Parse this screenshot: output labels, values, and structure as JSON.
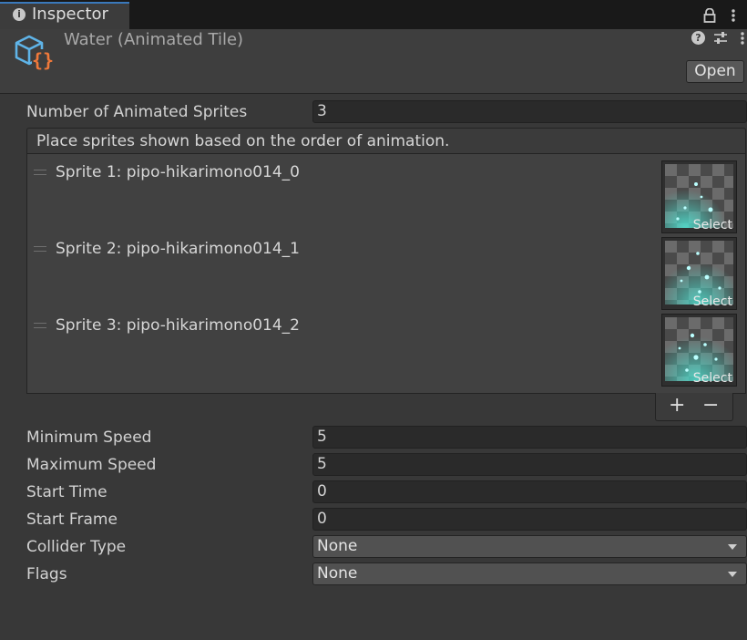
{
  "tab": {
    "label": "Inspector",
    "info_icon": "info-icon",
    "lock_icon": "lock-icon",
    "menu_icon": "kebab-menu-icon"
  },
  "header": {
    "title": "Water (Animated Tile)",
    "asset_icon": "scriptable-object-icon",
    "help_icon": "help-icon",
    "preset_icon": "presets-icon",
    "menu_icon": "kebab-menu-icon",
    "open_label": "Open"
  },
  "num_sprites": {
    "label": "Number of Animated Sprites",
    "value": "3"
  },
  "sprite_list": {
    "header": "Place sprites shown based on the order of animation.",
    "items": [
      {
        "label": "Sprite 1: pipo-hikarimono014_0",
        "select": "Select"
      },
      {
        "label": "Sprite 2: pipo-hikarimono014_1",
        "select": "Select"
      },
      {
        "label": "Sprite 3: pipo-hikarimono014_2",
        "select": "Select"
      }
    ],
    "add_label": "+",
    "remove_label": "−"
  },
  "fields": {
    "min_speed": {
      "label": "Minimum Speed",
      "value": "5"
    },
    "max_speed": {
      "label": "Maximum Speed",
      "value": "5"
    },
    "start_time": {
      "label": "Start Time",
      "value": "0"
    },
    "start_frame": {
      "label": "Start Frame",
      "value": "0"
    },
    "collider_type": {
      "label": "Collider Type",
      "value": "None"
    },
    "flags": {
      "label": "Flags",
      "value": "None"
    }
  },
  "colors": {
    "accent": "#3a79bb",
    "sparkle": "#4fe0d0",
    "icon_orange": "#f0793a",
    "icon_blue": "#5fb4e8"
  }
}
